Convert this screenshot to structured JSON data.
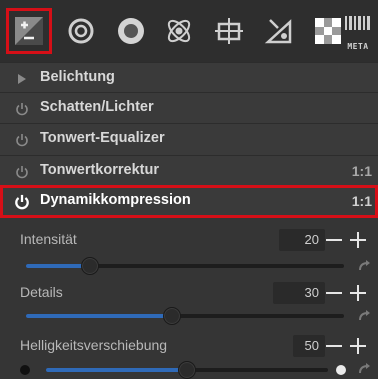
{
  "toolbar": {
    "tools": [
      {
        "name": "exposure-tab-icon",
        "active": true
      },
      {
        "name": "details-tab-icon",
        "active": false
      },
      {
        "name": "color-tab-icon",
        "active": false
      },
      {
        "name": "advanced-tab-icon",
        "active": false
      },
      {
        "name": "transform-tab-icon",
        "active": false
      },
      {
        "name": "raw-tab-icon",
        "active": false
      },
      {
        "name": "locallab-tab-icon",
        "active": false
      },
      {
        "name": "metadata-tab-icon",
        "active": false
      }
    ],
    "meta_label": "META"
  },
  "modules": [
    {
      "label": "Belichtung",
      "ratio": "",
      "icon": "expand-arrow-icon"
    },
    {
      "label": "Schatten/Lichter",
      "ratio": "",
      "icon": "power-icon"
    },
    {
      "label": "Tonwert-Equalizer",
      "ratio": "",
      "icon": "power-icon"
    },
    {
      "label": "Tonwertkorrektur",
      "ratio": "1:1",
      "icon": "power-icon"
    },
    {
      "label": "Dynamikkompression",
      "ratio": "1:1",
      "icon": "power-icon"
    }
  ],
  "params": [
    {
      "label": "Intensität",
      "value": "20",
      "fraction": 0.2
    },
    {
      "label": "Details",
      "value": "30",
      "fraction": 0.46
    },
    {
      "label": "Helligkeitsverschiebung",
      "value": "50",
      "fraction": 0.5
    }
  ],
  "colors": {
    "highlight": "#d60f17",
    "slider_fill": "#2f6ab8"
  }
}
